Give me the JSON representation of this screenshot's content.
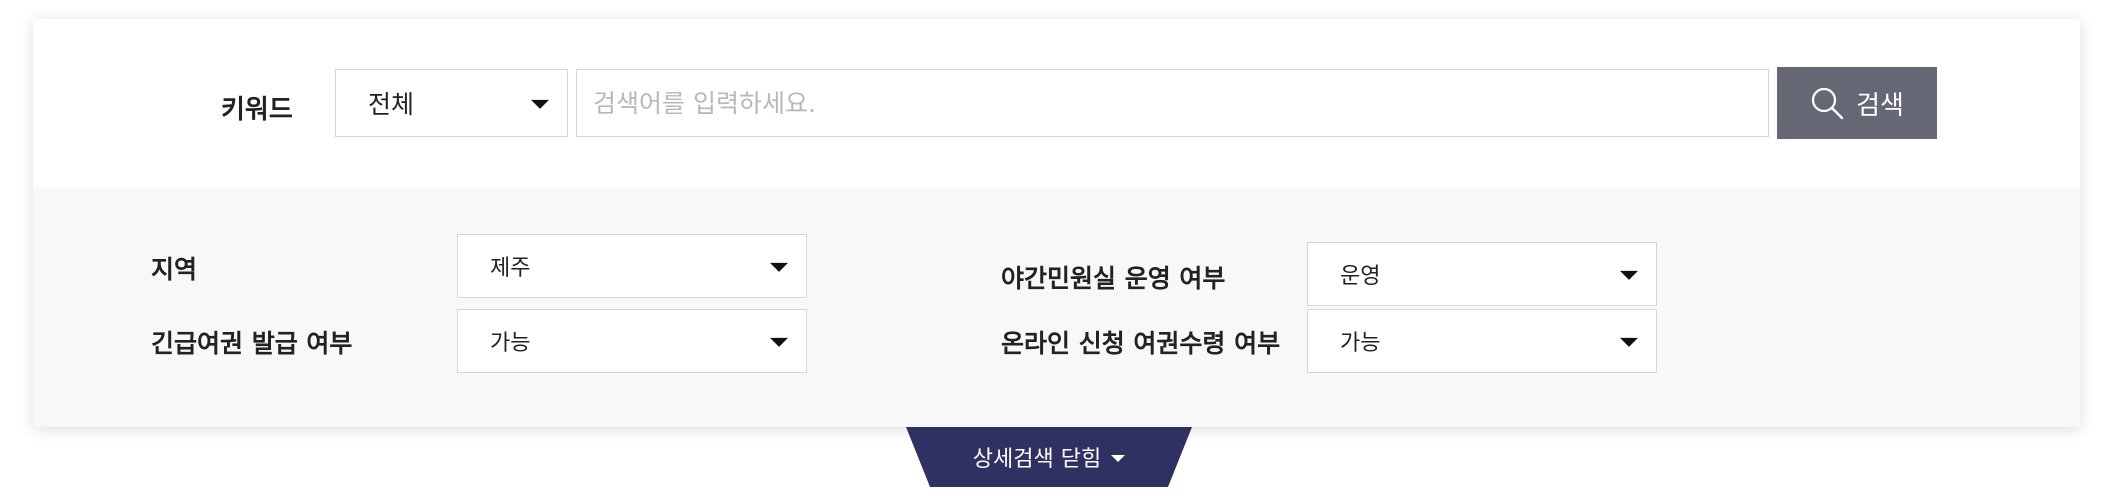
{
  "keyword": {
    "label": "키워드",
    "scope_selected": "전체",
    "input_value": "",
    "input_placeholder": "검색어를 입력하세요.",
    "search_label": "검색"
  },
  "filters": {
    "region": {
      "label": "지역",
      "selected": "제주"
    },
    "emergency_passport": {
      "label": "긴급여권 발급 여부",
      "selected": "가능"
    },
    "night_office": {
      "label": "야간민원실 운영 여부",
      "selected": "운영"
    },
    "online_pickup": {
      "label": "온라인 신청 여권수령 여부",
      "selected": "가능"
    }
  },
  "detail_toggle": {
    "label": "상세검색 닫힘"
  },
  "colors": {
    "search_button": "#656874",
    "toggle_tab": "#2f3163",
    "filter_background": "#f8f8f8"
  }
}
